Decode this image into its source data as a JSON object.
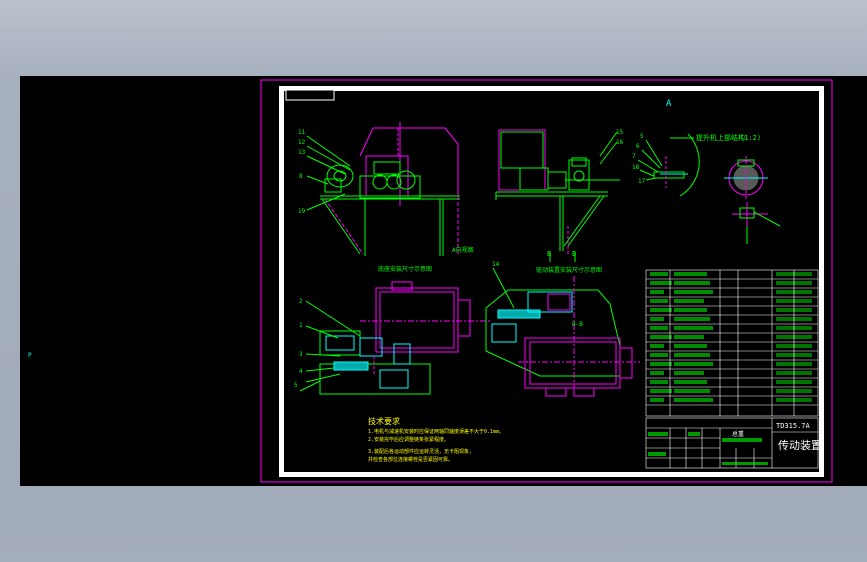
{
  "drawing": {
    "section_a_label": "A",
    "section_b_label": "B",
    "section_b2_label": "B",
    "view_a_title": "A向视图",
    "view_title_1": "底座安装尺寸示意图",
    "view_title_2": "驱动装置安装尺寸示意图",
    "view_b_title": "B-B",
    "detail_title": "提升机上部结构",
    "detail_ref": "(1:2)",
    "left_callouts": [
      "11",
      "12",
      "13",
      "8",
      "19"
    ],
    "right_callouts": [
      "15",
      "16"
    ],
    "detail_callouts": [
      "5",
      "6",
      "7",
      "18",
      "17"
    ],
    "plan_callouts": [
      "2",
      "1",
      "3",
      "4",
      "5"
    ],
    "plan_right_callout": "14",
    "small_marker": "P",
    "tech_title": "技术要求",
    "tech_notes": [
      "1.电机与减速机安装时应保证两轴同轴度误差不大于0.1mm。",
      "2.安装完毕后应调整链条张紧程度。",
      "3.装配后各运动部件应运转灵活，无卡阻现象，",
      "  并检查各部位连接螺栓是否紧固可靠。"
    ],
    "title_block": {
      "drawing_number": "TD315.7A",
      "drawing_name": "传动装置",
      "label": "总重"
    }
  },
  "colors": {
    "background": "#000000",
    "frame": "#ffffff",
    "outline": "#ff00ff",
    "hidden": "#ff00ff",
    "text": "#00ff00",
    "dimension": "#00ffff",
    "detail": "#ffff00"
  }
}
